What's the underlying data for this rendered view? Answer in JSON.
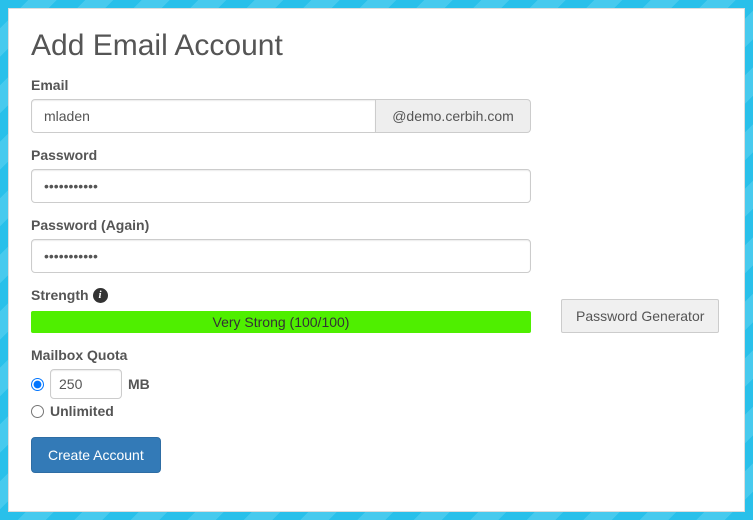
{
  "title": "Add Email Account",
  "email": {
    "label": "Email",
    "value": "mladen",
    "domain": "@demo.cerbih.com"
  },
  "password": {
    "label": "Password",
    "value": "•••••••••••"
  },
  "password_again": {
    "label": "Password (Again)",
    "value": "•••••••••••"
  },
  "strength": {
    "label": "Strength",
    "text": "Very Strong (100/100)"
  },
  "password_generator_label": "Password Generator",
  "quota": {
    "label": "Mailbox Quota",
    "value": "250",
    "unit": "MB",
    "unlimited_label": "Unlimited",
    "selected": "custom"
  },
  "submit_label": "Create Account"
}
